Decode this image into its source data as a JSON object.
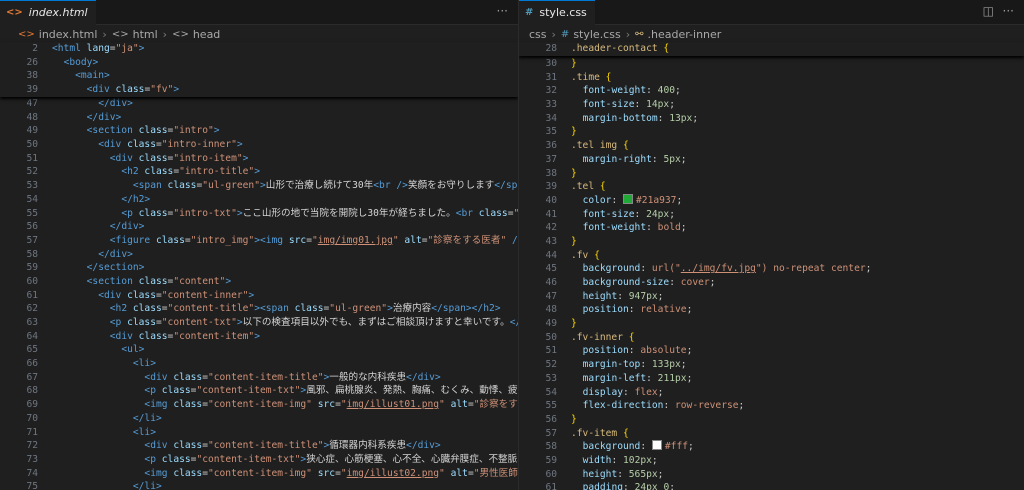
{
  "left": {
    "tab": {
      "label": "index.html",
      "icon": "html-icon"
    },
    "more": "···",
    "breadcrumb": [
      "index.html",
      "html",
      "head"
    ],
    "sticky": [
      {
        "n": "2",
        "html": "<span class='g'>&lt;html</span> <span class='a'>lang</span>=<span class='s'>\"ja\"</span><span class='g'>&gt;</span>"
      },
      {
        "n": "26",
        "html": "  <span class='g'>&lt;body&gt;</span>"
      },
      {
        "n": "38",
        "html": "    <span class='g'>&lt;main&gt;</span>"
      },
      {
        "n": "39",
        "html": "      <span class='g'>&lt;div</span> <span class='a'>class</span>=<span class='s'>\"fv\"</span><span class='g'>&gt;</span>"
      }
    ],
    "lines": [
      {
        "n": "47",
        "html": "        <span class='g'>&lt;/div&gt;</span>"
      },
      {
        "n": "48",
        "html": "      <span class='g'>&lt;/div&gt;</span>"
      },
      {
        "n": "49",
        "html": "      <span class='g'>&lt;section</span> <span class='a'>class</span>=<span class='s'>\"intro\"</span><span class='g'>&gt;</span>"
      },
      {
        "n": "50",
        "html": "        <span class='g'>&lt;div</span> <span class='a'>class</span>=<span class='s'>\"intro-inner\"</span><span class='g'>&gt;</span>"
      },
      {
        "n": "51",
        "html": "          <span class='g'>&lt;div</span> <span class='a'>class</span>=<span class='s'>\"intro-item\"</span><span class='g'>&gt;</span>"
      },
      {
        "n": "52",
        "html": "            <span class='g'>&lt;h2</span> <span class='a'>class</span>=<span class='s'>\"intro-title\"</span><span class='g'>&gt;</span>"
      },
      {
        "n": "53",
        "html": "              <span class='g'>&lt;span</span> <span class='a'>class</span>=<span class='s'>\"ul-green\"</span><span class='g'>&gt;</span><span class='x'>山形で治療し続けて30年</span><span class='g'>&lt;br</span> <span class='g'>/&gt;</span><span class='x'>笑顔をお守りします</span><span class='g'>&lt;/span&gt;</span>"
      },
      {
        "n": "54",
        "html": "            <span class='g'>&lt;/h2&gt;</span>"
      },
      {
        "n": "55",
        "html": "            <span class='g'>&lt;p</span> <span class='a'>class</span>=<span class='s'>\"intro-txt\"</span><span class='g'>&gt;</span><span class='x'>ここ山形の地で当院を開院し30年が経ちました。</span><span class='g'>&lt;br</span> <span class='a'>class</span>=<span class='s'>\"pc-br\"</span>"
      },
      {
        "n": "56",
        "html": "          <span class='g'>&lt;/div&gt;</span>"
      },
      {
        "n": "57",
        "html": "          <span class='g'>&lt;figure</span> <span class='a'>class</span>=<span class='s'>\"intro_img\"</span><span class='g'>&gt;&lt;img</span> <span class='a'>src</span>=<span class='s'>\"<span class='u'>img/img01.jpg</span>\"</span> <span class='a'>alt</span>=<span class='s'>\"診察をする医者\"</span> <span class='g'>/&gt;&lt;/fig</span>"
      },
      {
        "n": "58",
        "html": "        <span class='g'>&lt;/div&gt;</span>"
      },
      {
        "n": "59",
        "html": "      <span class='g'>&lt;/section&gt;</span>"
      },
      {
        "n": "60",
        "html": "      <span class='g'>&lt;section</span> <span class='a'>class</span>=<span class='s'>\"content\"</span><span class='g'>&gt;</span>"
      },
      {
        "n": "61",
        "html": "        <span class='g'>&lt;div</span> <span class='a'>class</span>=<span class='s'>\"content-inner\"</span><span class='g'>&gt;</span>"
      },
      {
        "n": "62",
        "html": "          <span class='g'>&lt;h2</span> <span class='a'>class</span>=<span class='s'>\"content-title\"</span><span class='g'>&gt;&lt;span</span> <span class='a'>class</span>=<span class='s'>\"ul-green\"</span><span class='g'>&gt;</span><span class='x'>治療内容</span><span class='g'>&lt;/span&gt;&lt;/h2&gt;</span>"
      },
      {
        "n": "63",
        "html": "          <span class='g'>&lt;p</span> <span class='a'>class</span>=<span class='s'>\"content-txt\"</span><span class='g'>&gt;</span><span class='x'>以下の検査項目以外でも、まずはご相談頂けますと幸いです。</span><span class='g'>&lt;/p&gt;</span>"
      },
      {
        "n": "64",
        "html": "          <span class='g'>&lt;div</span> <span class='a'>class</span>=<span class='s'>\"content-item\"</span><span class='g'>&gt;</span>"
      },
      {
        "n": "65",
        "html": "            <span class='g'>&lt;ul&gt;</span>"
      },
      {
        "n": "66",
        "html": "              <span class='g'>&lt;li&gt;</span>"
      },
      {
        "n": "67",
        "html": "                <span class='g'>&lt;div</span> <span class='a'>class</span>=<span class='s'>\"content-item-title\"</span><span class='g'>&gt;</span><span class='x'>一般的な内科疾患</span><span class='g'>&lt;/div&gt;</span>"
      },
      {
        "n": "68",
        "html": "                <span class='g'>&lt;p</span> <span class='a'>class</span>=<span class='s'>\"content-item-txt\"</span><span class='g'>&gt;</span><span class='x'>風邪、扁桃腺炎、発熱、胸痛、むくみ、動悸、疲れ・疲労</span>"
      },
      {
        "n": "69",
        "html": "                <span class='g'>&lt;img</span> <span class='a'>class</span>=<span class='s'>\"content-item-img\"</span> <span class='a'>src</span>=<span class='s'>\"<span class='u'>img/illust01.png</span>\"</span> <span class='a'>alt</span>=<span class='s'>\"診察をする女医\"</span>"
      },
      {
        "n": "70",
        "html": "              <span class='g'>&lt;/li&gt;</span>"
      },
      {
        "n": "71",
        "html": "              <span class='g'>&lt;li&gt;</span>"
      },
      {
        "n": "72",
        "html": "                <span class='g'>&lt;div</span> <span class='a'>class</span>=<span class='s'>\"content-item-title\"</span><span class='g'>&gt;</span><span class='x'>循環器内科系疾患</span><span class='g'>&lt;/div&gt;</span>"
      },
      {
        "n": "73",
        "html": "                <span class='g'>&lt;p</span> <span class='a'>class</span>=<span class='s'>\"content-item-txt\"</span><span class='g'>&gt;</span><span class='x'>狭心症、心筋梗塞、心不全、心臓弁膜症、不整脈、大動脈</span>"
      },
      {
        "n": "74",
        "html": "                <span class='g'>&lt;img</span> <span class='a'>class</span>=<span class='s'>\"content-item-img\"</span> <span class='a'>src</span>=<span class='s'>\"<span class='u'>img/illust02.png</span>\"</span> <span class='a'>alt</span>=<span class='s'>\"男性医師\"</span> <span class='g'>/&gt;</span>"
      },
      {
        "n": "75",
        "html": "              <span class='g'>&lt;/li&gt;</span>"
      }
    ]
  },
  "right": {
    "tab": {
      "label": "style.css",
      "icon": "css-icon"
    },
    "more": "···",
    "breadcrumb": [
      "css",
      "style.css",
      ".header-inner"
    ],
    "sticky": [
      {
        "n": "28",
        "html": "<span class='sel'>.header-contact</span> <span class='br'>{</span>"
      }
    ],
    "lines": [
      {
        "n": "30",
        "html": "<span class='br'>}</span>"
      },
      {
        "n": "31",
        "html": "<span class='sel'>.time</span> <span class='br'>{</span>"
      },
      {
        "n": "32",
        "html": "  <span class='p'>font-weight</span>: <span class='n'>400</span>;"
      },
      {
        "n": "33",
        "html": "  <span class='p'>font-size</span>: <span class='n'>14px</span>;"
      },
      {
        "n": "34",
        "html": "  <span class='p'>margin-bottom</span>: <span class='n'>13px</span>;"
      },
      {
        "n": "35",
        "html": "<span class='br'>}</span>"
      },
      {
        "n": "36",
        "html": "<span class='sel'>.tel img</span> <span class='br'>{</span>"
      },
      {
        "n": "37",
        "html": "  <span class='p'>margin-right</span>: <span class='n'>5px</span>;"
      },
      {
        "n": "38",
        "html": "<span class='br'>}</span>"
      },
      {
        "n": "39",
        "html": "<span class='sel'>.tel</span> <span class='br'>{</span>"
      },
      {
        "n": "40",
        "html": "  <span class='p'>color</span>: <span class='sw' style='background:#21a937'></span><span class='k'>#21a937</span>;"
      },
      {
        "n": "41",
        "html": "  <span class='p'>font-size</span>: <span class='n'>24px</span>;"
      },
      {
        "n": "42",
        "html": "  <span class='p'>font-weight</span>: <span class='k'>bold</span>;"
      },
      {
        "n": "43",
        "html": "<span class='br'>}</span>"
      },
      {
        "n": "44",
        "html": "<span class='sel'>.fv</span> <span class='br'>{</span>"
      },
      {
        "n": "45",
        "html": "  <span class='p'>background</span>: <span class='k'>url(</span><span class='k'>\"<span class='u'>../img/fv.jpg</span>\"</span><span class='k'>) no-repeat center</span>;"
      },
      {
        "n": "46",
        "html": "  <span class='p'>background-size</span>: <span class='k'>cover</span>;"
      },
      {
        "n": "47",
        "html": "  <span class='p'>height</span>: <span class='n'>947px</span>;"
      },
      {
        "n": "48",
        "html": "  <span class='p'>position</span>: <span class='k'>relative</span>;"
      },
      {
        "n": "49",
        "html": "<span class='br'>}</span>"
      },
      {
        "n": "50",
        "html": "<span class='sel'>.fv-inner</span> <span class='br'>{</span>"
      },
      {
        "n": "51",
        "html": "  <span class='p'>position</span>: <span class='k'>absolute</span>;"
      },
      {
        "n": "52",
        "html": "  <span class='p'>margin-top</span>: <span class='n'>133px</span>;"
      },
      {
        "n": "53",
        "html": "  <span class='p'>margin-left</span>: <span class='n'>211px</span>;"
      },
      {
        "n": "54",
        "html": "  <span class='p'>display</span>: <span class='k'>flex</span>;"
      },
      {
        "n": "55",
        "html": "  <span class='p'>flex-direction</span>: <span class='k'>row-reverse</span>;"
      },
      {
        "n": "56",
        "html": "<span class='br'>}</span>"
      },
      {
        "n": "57",
        "html": "<span class='sel'>.fv-item</span> <span class='br'>{</span>"
      },
      {
        "n": "58",
        "html": "  <span class='p'>background</span>: <span class='sw' style='background:#fff'></span><span class='k'>#fff</span>;"
      },
      {
        "n": "59",
        "html": "  <span class='p'>width</span>: <span class='n'>102px</span>;"
      },
      {
        "n": "60",
        "html": "  <span class='p'>height</span>: <span class='n'>565px</span>;"
      },
      {
        "n": "61",
        "html": "  <span class='p'>padding</span>: <span class='n'>24px 0</span>;"
      }
    ]
  }
}
